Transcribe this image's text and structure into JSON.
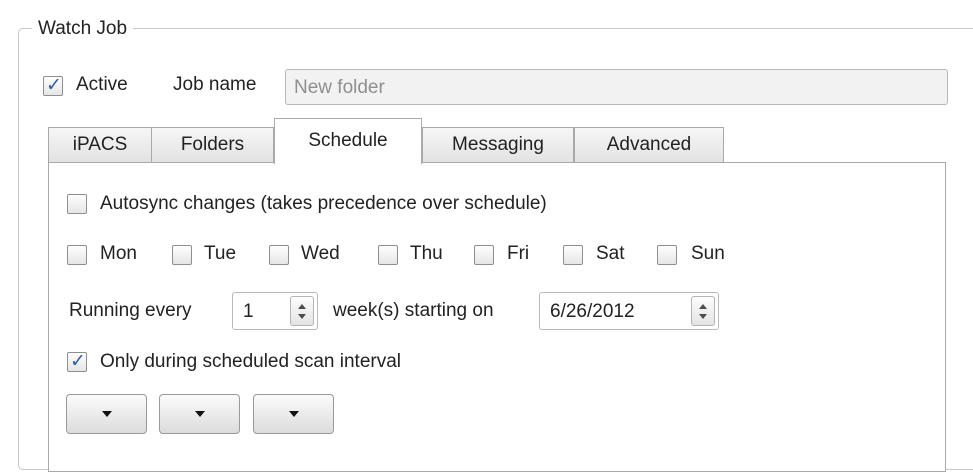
{
  "watch_job": {
    "title": "Watch Job",
    "active": {
      "label": "Active",
      "checked": true
    },
    "job_name": {
      "label": "Job name",
      "placeholder": "New folder"
    }
  },
  "tabs": [
    {
      "label": "iPACS",
      "selected": false
    },
    {
      "label": "Folders",
      "selected": false
    },
    {
      "label": "Schedule",
      "selected": true
    },
    {
      "label": "Messaging",
      "selected": false
    },
    {
      "label": "Advanced",
      "selected": false
    }
  ],
  "schedule": {
    "autosync": {
      "label": "Autosync changes (takes precedence over schedule)",
      "checked": false
    },
    "days": [
      {
        "label": "Mon",
        "checked": false
      },
      {
        "label": "Tue",
        "checked": false
      },
      {
        "label": "Wed",
        "checked": false
      },
      {
        "label": "Thu",
        "checked": false
      },
      {
        "label": "Fri",
        "checked": false
      },
      {
        "label": "Sat",
        "checked": false
      },
      {
        "label": "Sun",
        "checked": false
      }
    ],
    "running_every_label": "Running every",
    "interval_value": "1",
    "weeks_starting_label": "week(s) starting on",
    "start_date": "6/26/2012",
    "only_scheduled": {
      "label": "Only during scheduled scan interval",
      "checked": true
    },
    "dropdowns": [
      {
        "value": ""
      },
      {
        "value": ""
      },
      {
        "value": ""
      }
    ]
  },
  "colors": {
    "check_mark": "#2c5ea8",
    "border": "#a9a9a9",
    "input_disabled_bg": "#f2f2f2"
  }
}
